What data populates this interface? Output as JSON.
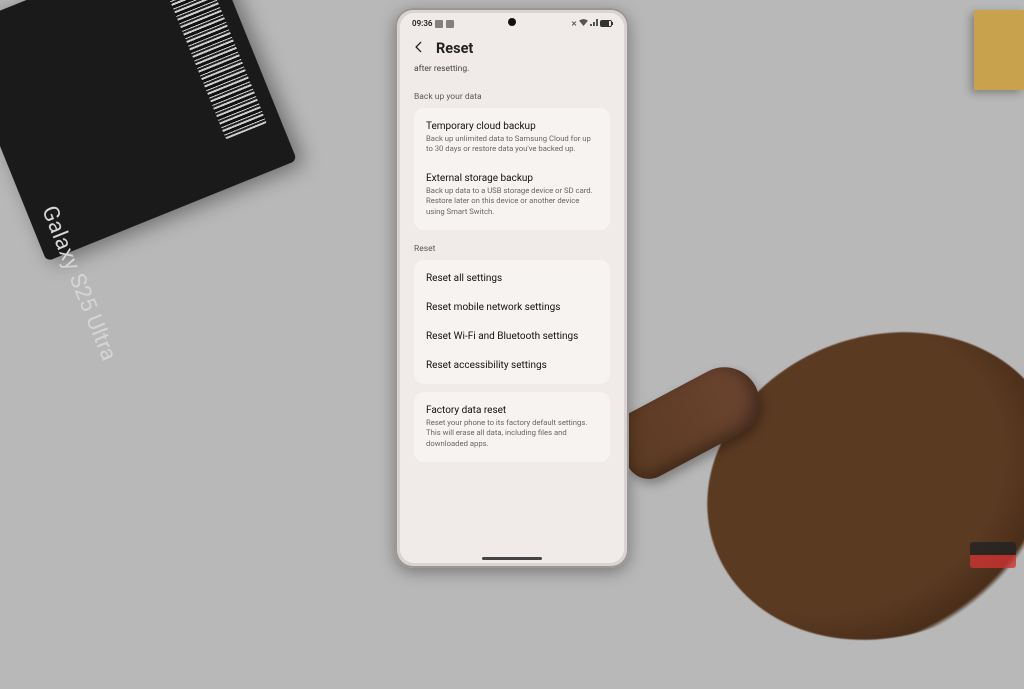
{
  "box_label": "Galaxy S25 Ultra",
  "statusbar": {
    "time": "09:36"
  },
  "header": {
    "title": "Reset"
  },
  "intro_fragment": "after resetting.",
  "sections": {
    "backup_label": "Back up your data",
    "reset_label": "Reset"
  },
  "backup": [
    {
      "title": "Temporary cloud backup",
      "desc": "Back up unlimited data to Samsung Cloud for up to 30 days or restore data you've backed up."
    },
    {
      "title": "External storage backup",
      "desc": "Back up data to a USB storage device or SD card. Restore later on this device or another device using Smart Switch."
    }
  ],
  "reset_items": [
    {
      "title": "Reset all settings"
    },
    {
      "title": "Reset mobile network settings"
    },
    {
      "title": "Reset Wi-Fi and Bluetooth settings"
    },
    {
      "title": "Reset accessibility settings"
    }
  ],
  "factory": {
    "title": "Factory data reset",
    "desc": "Reset your phone to its factory default settings. This will erase all data, including files and downloaded apps."
  }
}
